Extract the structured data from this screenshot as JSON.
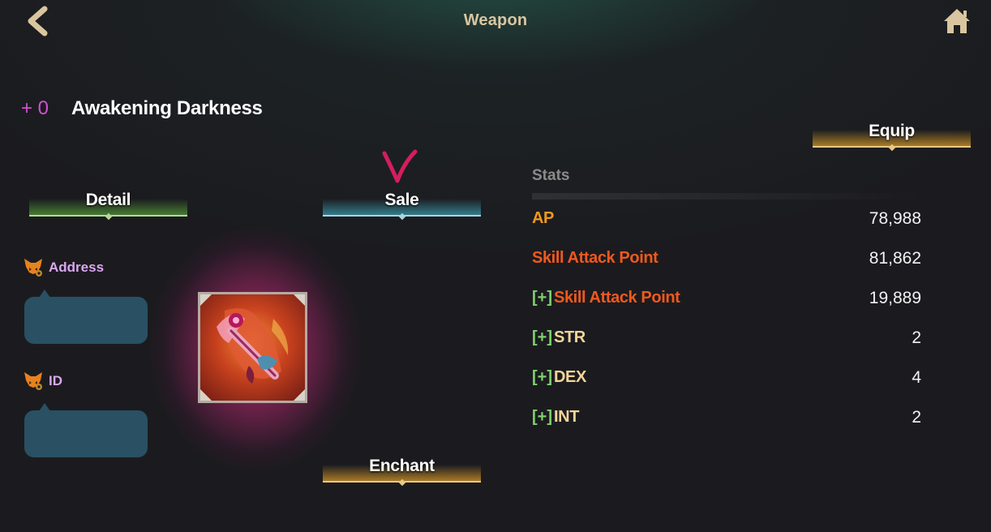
{
  "header": {
    "title": "Weapon",
    "back_icon": "back-arrow-icon",
    "home_icon": "home-icon"
  },
  "item": {
    "enhance_level": "+ 0",
    "name": "Awakening Darkness"
  },
  "tabs": {
    "detail": "Detail",
    "sale": "Sale",
    "enchant": "Enchant",
    "equip": "Equip"
  },
  "info": {
    "address_label": "Address",
    "id_label": "ID",
    "address_value": "",
    "id_value": ""
  },
  "stats": {
    "title": "Stats",
    "rows": [
      {
        "prefix": "",
        "name": "AP",
        "value": "78,988",
        "color": "#f09a1e"
      },
      {
        "prefix": "",
        "name": "Skill Attack Point",
        "value": "81,862",
        "color": "#f0591e"
      },
      {
        "prefix": "[+]",
        "name": "Skill Attack Point",
        "value": "19,889",
        "color": "#f0591e"
      },
      {
        "prefix": "[+]",
        "name": "STR",
        "value": "2",
        "color": "#f2d59a"
      },
      {
        "prefix": "[+]",
        "name": "DEX",
        "value": "4",
        "color": "#f2d59a"
      },
      {
        "prefix": "[+]",
        "name": "INT",
        "value": "2",
        "color": "#f2d59a"
      }
    ]
  },
  "colors": {
    "accent_gold": "#e8c987",
    "enhance_magenta": "#d34fd1",
    "check_mark": "#d41e5c"
  }
}
